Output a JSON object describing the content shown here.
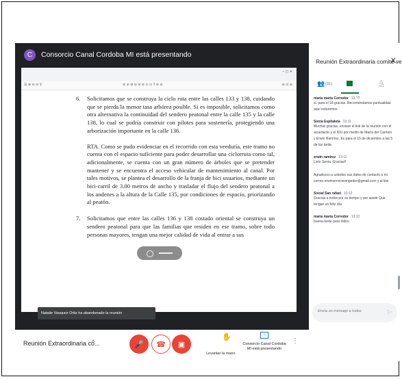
{
  "presentation": {
    "avatar_letter": "C",
    "title": "Consorcio Canal Cordoba MI está presentando"
  },
  "document": {
    "items": [
      {
        "num": "6.",
        "text": "Solicitamos que se construya la ciclo ruta entre las calles 133 y 138, cuidando que se pierda la menor tasa arbórea posible. Si es imposible, solicitamos como otra alternativa la continuidad del sendero peatonal entre la calle 135 y la calle 138, lo cual se podría construir con pilotes para sostenería, protegiendo una arborización importante en la calle 136."
      },
      {
        "num": "",
        "text": "RTA. Como se pudo evidenciar en el recorrido con esta veeduría, este tramo no cuenta con el espacio suficiente para poder desarrollar una ciclorruta como tal, adicionalmente, se cuenta con un gran número de árboles que se pretender mantener y se encuentra el acceso vehicular de mantenimiento al canal. Por tales motivos, se plantea el desarrollo de la franja de bici usuarios, mediante un bici-carril de 3.00 metros de ancho y trasladar el flujo del sendero peatonal a los andenes a la altura de la Calle 135, por condiciones de espacio, priorizando al peatón."
      },
      {
        "num": "7.",
        "text": "Solicitamos que entre las calles 136 y 138 costado oriental se construya un sendero peatonal para que las familias que residen en ese tramo, sobre todo personas mayores, tengan una mejor calidad de vida al entrar a sus"
      }
    ]
  },
  "toast": "Natalie Vasquez Ortiz ha abandonado la reunión",
  "bottom_bar": {
    "meeting_name": "Reunión Extraordinaria co...",
    "caret": "^",
    "raise_hand": "Levantar la mano",
    "presenting": "Consorcio Canal Cordoba MI está presentando"
  },
  "panel": {
    "title": "Reunión Extraordinaria comité ve...",
    "close": "X",
    "people_count": "(31)",
    "messages": [
      {
        "sender": "maria maria Corredor",
        "time": "13:??",
        "text": "si, para el 18 gracias. Recomendamos puntualidad aquí estaremos"
      },
      {
        "sender": "Sonia Espitaleta",
        "time": "13:11",
        "text": "Muchas gracias, enviaré el link de la reunión con el acueducto y el IDU por medio de María del Carmen y Erwin Ramírez. Es para el 15 de diciembre a las 5 de las tarde."
      },
      {
        "sender": "erwin ramirez",
        "time": "13:11",
        "text": "Listo Sonia. Gracias!!"
      },
      {
        "sender": "",
        "time": "",
        "text": "Agradezco a ustedes sus datos de contacto a mi correo erwinserviciosingeder@gmail.com y al link"
      },
      {
        "sender": "Social San rafael",
        "time": "13:12",
        "text": "Gracias a todos por su tiempo y por asistir Que tengan un feliz día"
      },
      {
        "sender": "maria maria Corredor",
        "time": "13:12",
        "text": "buena tarde para todos"
      }
    ],
    "input_placeholder": "Envía un mensaje a todos"
  }
}
